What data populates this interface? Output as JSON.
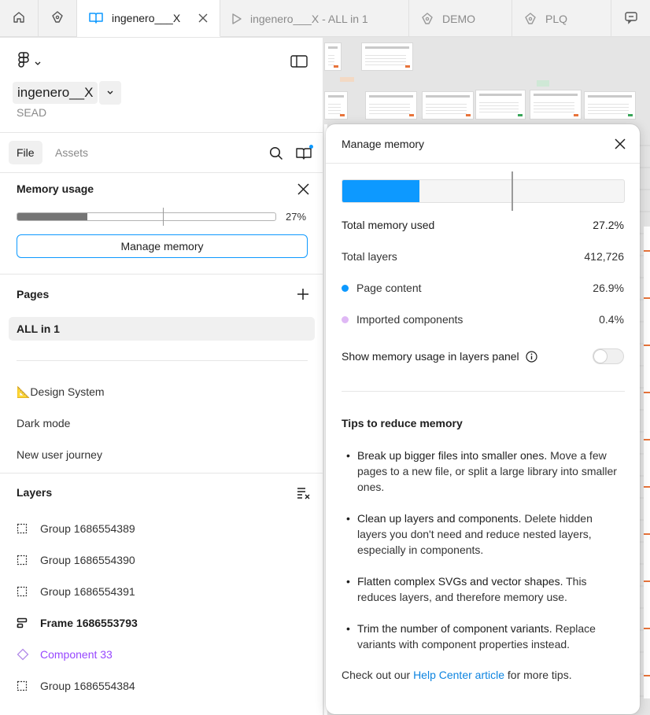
{
  "tabs": [
    {
      "label": "ingenero___X",
      "icon": "book-icon",
      "active": true
    },
    {
      "label": "ingenero___X - ALL in 1",
      "icon": "play-icon"
    },
    {
      "label": "DEMO",
      "icon": "pen-icon"
    },
    {
      "label": "PLQ",
      "icon": "pen-icon"
    }
  ],
  "file": {
    "name": "ingenero__X",
    "team": "SEAD"
  },
  "panel_tabs": {
    "file": "File",
    "assets": "Assets"
  },
  "memory": {
    "title": "Memory usage",
    "percent_label": "27%",
    "usage_fraction": 0.27,
    "limit_marker_fraction": 0.6,
    "manage_button": "Manage memory"
  },
  "pages": {
    "title": "Pages",
    "items": [
      "ALL in 1",
      "📐Design System",
      "Dark mode",
      "New user journey"
    ],
    "selected": "ALL in 1"
  },
  "layers": {
    "title": "Layers",
    "items": [
      {
        "label": "Group 1686554389",
        "type": "group"
      },
      {
        "label": "Group 1686554390",
        "type": "group"
      },
      {
        "label": "Group 1686554391",
        "type": "group"
      },
      {
        "label": "Frame 1686553793",
        "type": "frame"
      },
      {
        "label": "Component 33",
        "type": "component"
      },
      {
        "label": "Group 1686554384",
        "type": "group"
      }
    ]
  },
  "modal": {
    "title": "Manage memory",
    "bar_fraction": 0.272,
    "limit_marker_fraction": 0.6,
    "stats": [
      {
        "label": "Total memory used",
        "value": "27.2%"
      },
      {
        "label": "Total layers",
        "value": "412,726"
      },
      {
        "label": "Page content",
        "value": "26.9%",
        "dot": "#0d99ff"
      },
      {
        "label": "Imported components",
        "value": "0.4%",
        "dot": "#dfb8f5"
      }
    ],
    "toggle_label": "Show memory usage in layers panel",
    "toggle_on": false,
    "tips_title": "Tips to reduce memory",
    "tips": [
      {
        "bold": "Break up bigger files into smaller ones.",
        "rest": " Move a few pages to a new file, or split a large library into smaller ones."
      },
      {
        "bold": "Clean up layers and components.",
        "rest": " Delete hidden layers you don't need and reduce nested layers, especially in components."
      },
      {
        "bold": "Flatten complex SVGs and vector shapes.",
        "rest": " This reduces layers, and therefore memory use."
      },
      {
        "bold": "Trim the number of component variants.",
        "rest": " Replace variants with component properties instead."
      }
    ],
    "footer_prefix": "Check out our ",
    "footer_link": "Help Center article",
    "footer_suffix": " for more tips."
  },
  "colors": {
    "accent": "#0d99ff",
    "component": "#9747ff",
    "memory_bar": "#757575"
  }
}
